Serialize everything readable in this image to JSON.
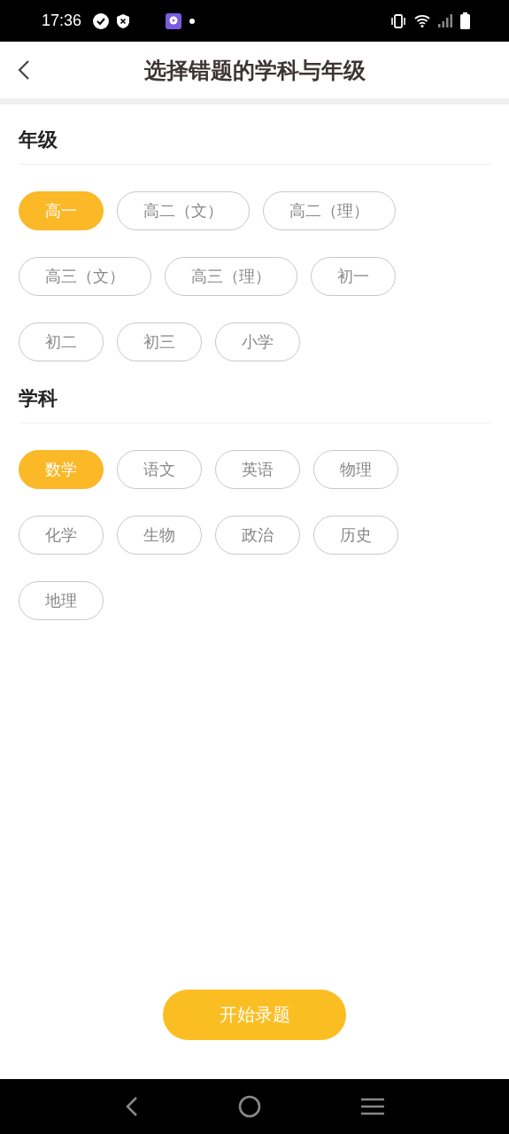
{
  "status_bar": {
    "time": "17:36"
  },
  "header": {
    "title": "选择错题的学科与年级"
  },
  "sections": [
    {
      "title": "年级",
      "options": [
        {
          "label": "高一",
          "selected": true
        },
        {
          "label": "高二（文）",
          "selected": false
        },
        {
          "label": "高二（理）",
          "selected": false
        },
        {
          "label": "高三（文）",
          "selected": false
        },
        {
          "label": "高三（理）",
          "selected": false
        },
        {
          "label": "初一",
          "selected": false
        },
        {
          "label": "初二",
          "selected": false
        },
        {
          "label": "初三",
          "selected": false
        },
        {
          "label": "小学",
          "selected": false
        }
      ]
    },
    {
      "title": "学科",
      "options": [
        {
          "label": "数学",
          "selected": true
        },
        {
          "label": "语文",
          "selected": false
        },
        {
          "label": "英语",
          "selected": false
        },
        {
          "label": "物理",
          "selected": false
        },
        {
          "label": "化学",
          "selected": false
        },
        {
          "label": "生物",
          "selected": false
        },
        {
          "label": "政治",
          "selected": false
        },
        {
          "label": "历史",
          "selected": false
        },
        {
          "label": "地理",
          "selected": false
        }
      ]
    }
  ],
  "start_button": "开始录题"
}
